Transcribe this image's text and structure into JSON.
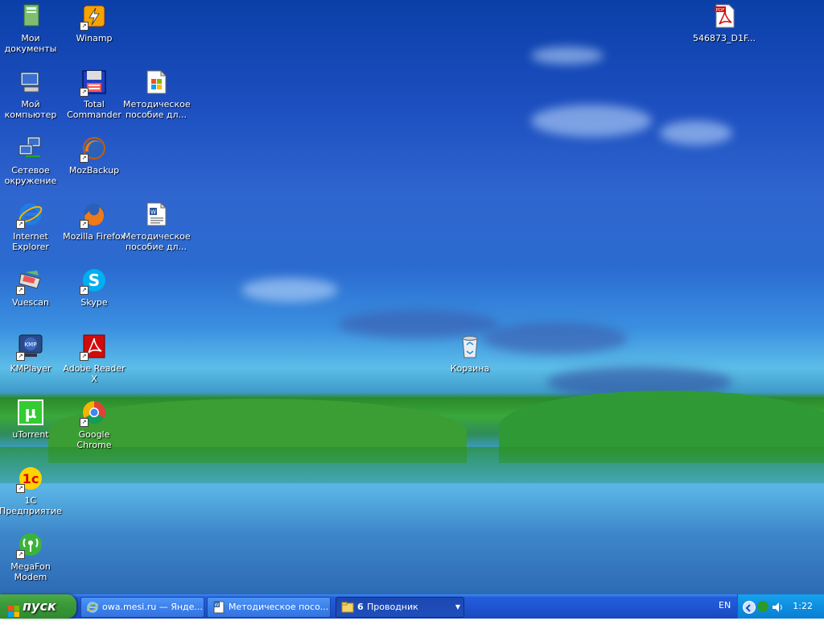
{
  "desktop": {
    "icons": [
      {
        "label": "Мои\nдокументы",
        "icon": "my-documents-icon"
      },
      {
        "label": "Winamp",
        "icon": "winamp-icon"
      },
      {
        "label": "546873_D1F...",
        "icon": "pdf-file-icon"
      },
      {
        "label": "Мой\nкомпьютер",
        "icon": "my-computer-icon"
      },
      {
        "label": "Total\nCommander",
        "icon": "total-commander-icon"
      },
      {
        "label": "Методическое\nпособие дл...",
        "icon": "word-document-icon"
      },
      {
        "label": "Сетевое\nокружение",
        "icon": "network-places-icon"
      },
      {
        "label": "MozBackup",
        "icon": "mozbackup-icon"
      },
      {
        "label": "Internet\nExplorer",
        "icon": "internet-explorer-icon"
      },
      {
        "label": "Mozilla Firefox",
        "icon": "firefox-icon"
      },
      {
        "label": "Методическое\nпособие дл...",
        "icon": "word-document-icon"
      },
      {
        "label": "Vuescan",
        "icon": "vuescan-icon"
      },
      {
        "label": "Skype",
        "icon": "skype-icon"
      },
      {
        "label": "KMPlayer",
        "icon": "kmplayer-icon"
      },
      {
        "label": "Adobe Reader\nX",
        "icon": "adobe-reader-icon"
      },
      {
        "label": "Корзина",
        "icon": "recycle-bin-icon"
      },
      {
        "label": "uTorrent",
        "icon": "utorrent-icon"
      },
      {
        "label": "Google Chrome",
        "icon": "chrome-icon"
      },
      {
        "label": "1С\nПредприятие",
        "icon": "1c-enterprise-icon"
      },
      {
        "label": "MegaFon\nModem",
        "icon": "megafon-modem-icon"
      }
    ]
  },
  "taskbar": {
    "start_label": "пуск",
    "tasks": [
      {
        "label": "owa.mesi.ru — Янде...",
        "icon": "internet-explorer-icon",
        "active": false
      },
      {
        "label": "Методическое посо...",
        "icon": "word-document-icon",
        "active": false
      },
      {
        "count": "6",
        "label": "Проводник",
        "icon": "folder-icon",
        "active": true
      }
    ],
    "language": "EN",
    "clock": "1:22"
  },
  "colors": {
    "taskbar_blue": "#245edb",
    "start_green": "#3c9a3a",
    "tray_blue": "#0f8ee0"
  }
}
